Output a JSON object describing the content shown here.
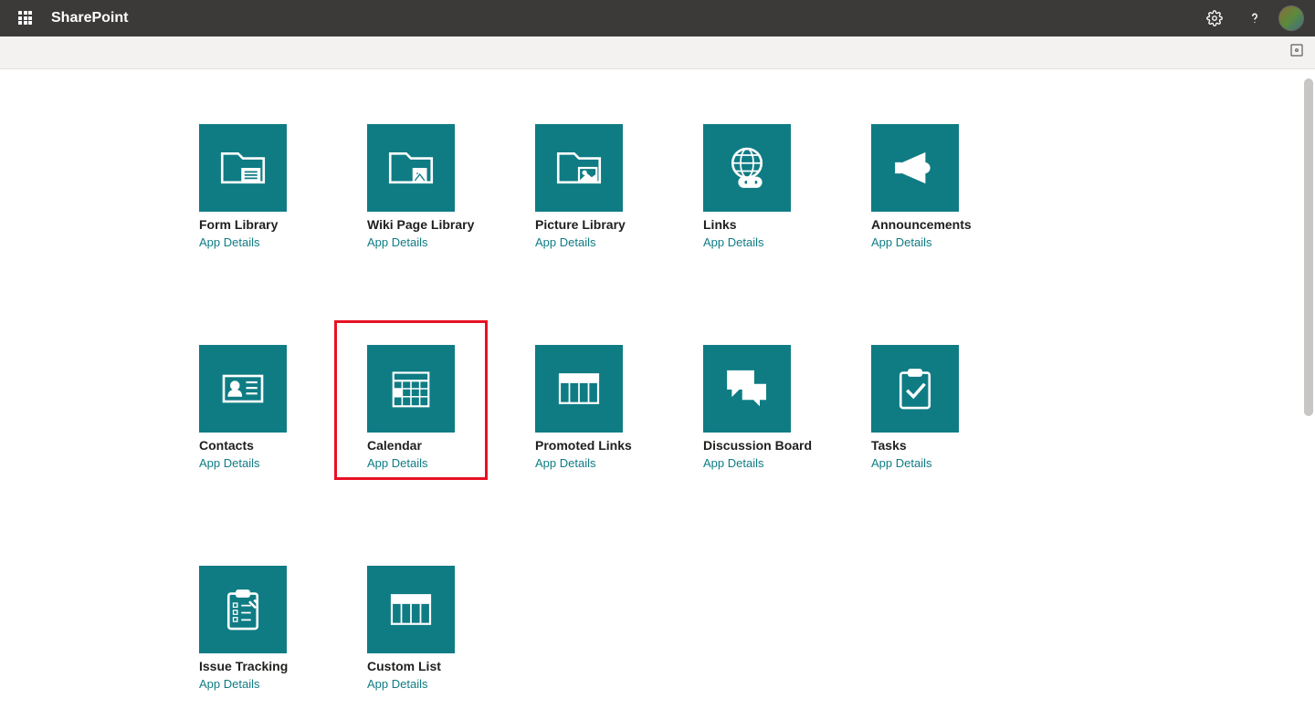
{
  "header": {
    "brand": "SharePoint"
  },
  "colors": {
    "accent": "#0f7c84",
    "highlight": "#e81123",
    "topbar": "#3b3a39"
  },
  "highlighted": "calendar",
  "apps": [
    {
      "key": "form-library",
      "title": "Form Library",
      "details": "App Details",
      "icon": "folder-form"
    },
    {
      "key": "wiki-page-library",
      "title": "Wiki Page Library",
      "details": "App Details",
      "icon": "folder-wiki"
    },
    {
      "key": "picture-library",
      "title": "Picture Library",
      "details": "App Details",
      "icon": "folder-picture"
    },
    {
      "key": "links",
      "title": "Links",
      "details": "App Details",
      "icon": "globe-link"
    },
    {
      "key": "announcements",
      "title": "Announcements",
      "details": "App Details",
      "icon": "megaphone"
    },
    {
      "key": "contacts",
      "title": "Contacts",
      "details": "App Details",
      "icon": "contact-card"
    },
    {
      "key": "calendar",
      "title": "Calendar",
      "details": "App Details",
      "icon": "calendar"
    },
    {
      "key": "promoted-links",
      "title": "Promoted Links",
      "details": "App Details",
      "icon": "table"
    },
    {
      "key": "discussion-board",
      "title": "Discussion Board",
      "details": "App Details",
      "icon": "chat"
    },
    {
      "key": "tasks",
      "title": "Tasks",
      "details": "App Details",
      "icon": "clipboard-check"
    },
    {
      "key": "issue-tracking",
      "title": "Issue Tracking",
      "details": "App Details",
      "icon": "clipboard-list"
    },
    {
      "key": "custom-list",
      "title": "Custom List",
      "details": "App Details",
      "icon": "table"
    }
  ]
}
